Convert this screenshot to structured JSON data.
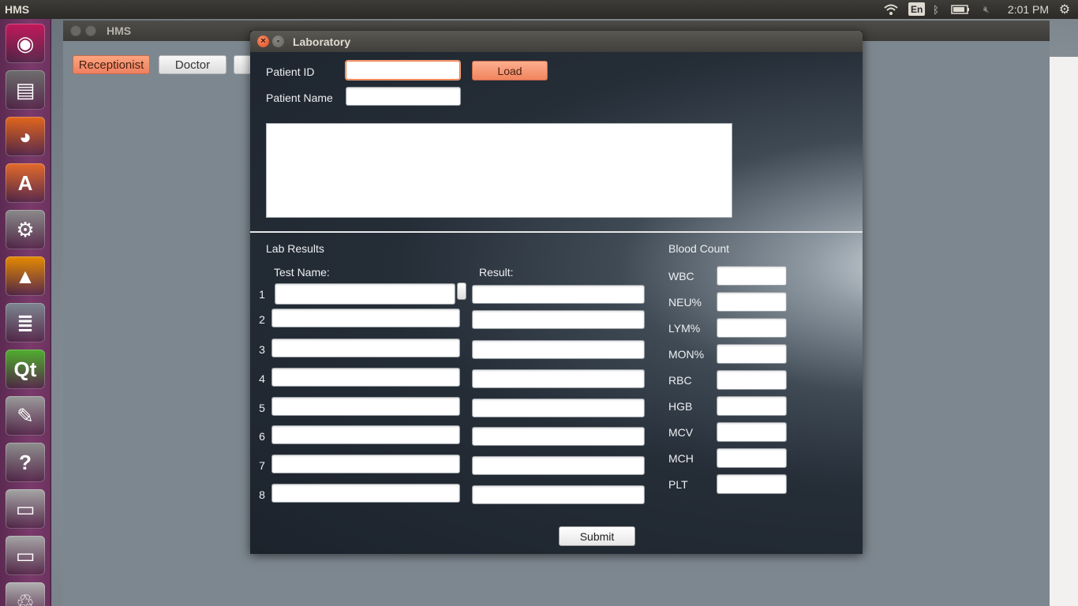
{
  "top_panel": {
    "app_title": "HMS",
    "keyboard_layout": "En",
    "clock": "2:01 PM",
    "indicators": [
      "wifi-icon",
      "keyboard-icon",
      "bluetooth-icon",
      "battery-icon",
      "volume-muted-icon",
      "settings-gear-icon"
    ]
  },
  "launcher": {
    "items": [
      {
        "name": "ubuntu-dash",
        "icon": "ubuntu-logo-icon",
        "glyph": "◉",
        "color": "#c2185b"
      },
      {
        "name": "files",
        "icon": "file-cabinet-icon",
        "glyph": "▤",
        "color": "#6d6d6d"
      },
      {
        "name": "firefox",
        "icon": "firefox-icon",
        "glyph": "◕",
        "color": "#e2661b"
      },
      {
        "name": "software-center",
        "icon": "shopping-bag-icon",
        "glyph": "A",
        "color": "#e46a2a"
      },
      {
        "name": "system-settings",
        "icon": "wrench-gear-icon",
        "glyph": "⚙",
        "color": "#8a8a8a"
      },
      {
        "name": "vlc",
        "icon": "traffic-cone-icon",
        "glyph": "▲",
        "color": "#e58a00"
      },
      {
        "name": "database",
        "icon": "database-icon",
        "glyph": "≣",
        "color": "#7d8690"
      },
      {
        "name": "qt-creator",
        "icon": "qt-logo-icon",
        "glyph": "Qt",
        "color": "#4fae2d"
      },
      {
        "name": "text-editor",
        "icon": "text-editor-icon",
        "glyph": "✎",
        "color": "#9a9a9a"
      },
      {
        "name": "help",
        "icon": "question-mark-icon",
        "glyph": "?",
        "color": "#8e8e8e"
      },
      {
        "name": "drive-1",
        "icon": "hard-drive-icon",
        "glyph": "▭",
        "color": "#a5a5a5"
      },
      {
        "name": "drive-2",
        "icon": "hard-drive-icon",
        "glyph": "▭",
        "color": "#a5a5a5"
      },
      {
        "name": "trash",
        "icon": "trash-icon",
        "glyph": "♲",
        "color": "#b0b0b0"
      }
    ]
  },
  "hms_window": {
    "title": "HMS",
    "tabs": [
      {
        "label": "Receptionist",
        "active": true
      },
      {
        "label": "Doctor",
        "active": false
      },
      {
        "label": "",
        "active": false
      }
    ]
  },
  "lab_dialog": {
    "title": "Laboratory",
    "patient_id_label": "Patient ID",
    "patient_id_value": "",
    "patient_name_label": "Patient Name",
    "patient_name_value": "",
    "load_label": "Load",
    "notes_value": "",
    "lab_results_label": "Lab Results",
    "test_name_header": "Test Name:",
    "result_header": "Result:",
    "rows": [
      {
        "num": "1",
        "test": "",
        "result": ""
      },
      {
        "num": "2",
        "test": "",
        "result": ""
      },
      {
        "num": "3",
        "test": "",
        "result": ""
      },
      {
        "num": "4",
        "test": "",
        "result": ""
      },
      {
        "num": "5",
        "test": "",
        "result": ""
      },
      {
        "num": "6",
        "test": "",
        "result": ""
      },
      {
        "num": "7",
        "test": "",
        "result": ""
      },
      {
        "num": "8",
        "test": "",
        "result": ""
      }
    ],
    "blood_count_label": "Blood Count",
    "blood_count": [
      {
        "label": "WBC",
        "value": ""
      },
      {
        "label": "NEU%",
        "value": ""
      },
      {
        "label": "LYM%",
        "value": ""
      },
      {
        "label": "MON%",
        "value": ""
      },
      {
        "label": "RBC",
        "value": ""
      },
      {
        "label": "HGB",
        "value": ""
      },
      {
        "label": "MCV",
        "value": ""
      },
      {
        "label": "MCH",
        "value": ""
      },
      {
        "label": "PLT",
        "value": ""
      }
    ],
    "submit_label": "Submit"
  },
  "colors": {
    "accent_orange": "#f1845f",
    "launcher_bg": "#7a3a6b",
    "panel_bg": "#2b2a27",
    "dialog_bg": "#1c232c"
  }
}
